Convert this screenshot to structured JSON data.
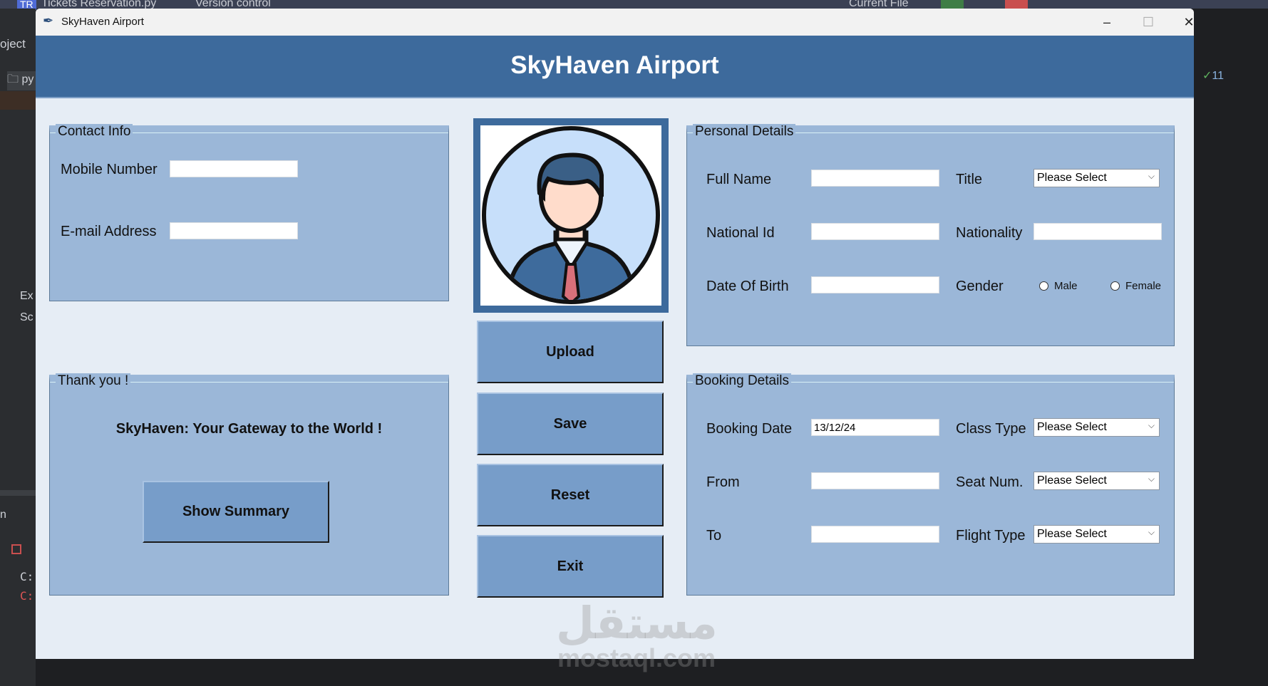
{
  "ide": {
    "tab_file": "Tickets Reservation.py",
    "tab_vcs": "Version control",
    "run_config": "Current File",
    "badge": "TR",
    "project_label": "oject",
    "tree": [
      "py",
      "Ex",
      "Sc"
    ],
    "run_label": "n",
    "console": [
      "C:",
      "C:"
    ],
    "check_count": "11"
  },
  "window": {
    "title": "SkyHaven Airport",
    "minimize": "–",
    "maximize": "☐",
    "close": "✕"
  },
  "header": {
    "title": "SkyHaven Airport"
  },
  "contact": {
    "legend": "Contact Info",
    "mobile_label": "Mobile Number",
    "mobile_value": "",
    "email_label": "E-mail Address",
    "email_value": ""
  },
  "thanks": {
    "legend": "Thank you !",
    "tagline": "SkyHaven: Your Gateway to the World !",
    "summary_button": "Show Summary"
  },
  "actions": {
    "upload": "Upload",
    "save": "Save",
    "reset": "Reset",
    "exit": "Exit"
  },
  "personal": {
    "legend": "Personal Details",
    "full_name_label": "Full Name",
    "full_name_value": "",
    "title_label": "Title",
    "title_value": "Please Select",
    "national_id_label": "National Id",
    "national_id_value": "",
    "nationality_label": "Nationality",
    "nationality_value": "",
    "dob_label": "Date Of Birth",
    "dob_value": "",
    "gender_label": "Gender",
    "gender_options": [
      "Male",
      "Female"
    ]
  },
  "booking": {
    "legend": "Booking Details",
    "date_label": "Booking Date",
    "date_value": "13/12/24",
    "class_label": "Class Type",
    "class_value": "Please Select",
    "from_label": "From",
    "from_value": "",
    "seat_label": "Seat Num.",
    "seat_value": "Please Select",
    "to_label": "To",
    "to_value": "",
    "flight_label": "Flight Type",
    "flight_value": "Please Select"
  },
  "watermark": {
    "arabic": "مستقل",
    "latin": "mostaql.com"
  }
}
